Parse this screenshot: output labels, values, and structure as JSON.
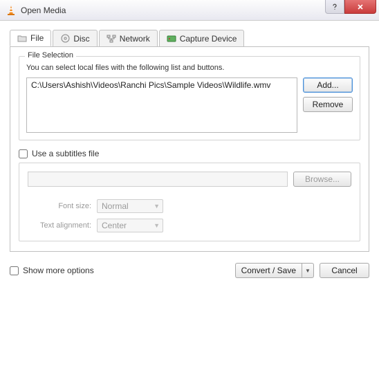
{
  "window": {
    "title": "Open Media"
  },
  "tabs": {
    "file": "File",
    "disc": "Disc",
    "network": "Network",
    "capture": "Capture Device"
  },
  "file_selection": {
    "group_title": "File Selection",
    "instruction": "You can select local files with the following list and buttons.",
    "items": [
      "C:\\Users\\Ashish\\Videos\\Ranchi Pics\\Sample Videos\\Wildlife.wmv"
    ],
    "add_label": "Add...",
    "remove_label": "Remove"
  },
  "subtitles": {
    "checkbox_label": "Use a subtitles file",
    "browse_label": "Browse...",
    "font_size_label": "Font size:",
    "font_size_value": "Normal",
    "text_align_label": "Text alignment:",
    "text_align_value": "Center"
  },
  "options": {
    "show_more_label": "Show more options"
  },
  "footer": {
    "convert_label": "Convert / Save",
    "cancel_label": "Cancel"
  }
}
